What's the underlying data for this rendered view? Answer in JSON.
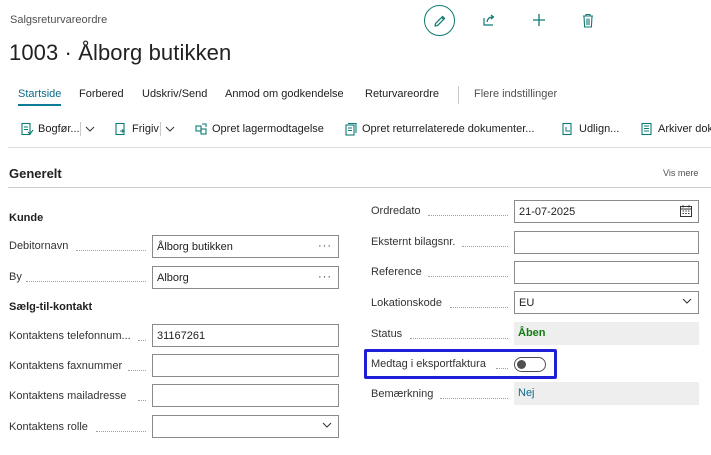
{
  "page": {
    "type": "Salgsreturvareordre",
    "title": "1003 · Ålborg butikken"
  },
  "header_actions": {
    "edit_icon": "pencil-icon",
    "share_icon": "share-icon",
    "add_icon": "plus-icon",
    "delete_icon": "trash-icon"
  },
  "tabs": [
    {
      "label": "Startside",
      "active": true
    },
    {
      "label": "Forbered"
    },
    {
      "label": "Udskriv/Send"
    },
    {
      "label": "Anmod om godkendelse"
    },
    {
      "label": "Returvareordre"
    },
    {
      "label": "Flere indstillinger"
    }
  ],
  "actions": [
    {
      "label": "Bogfør..."
    },
    {
      "label": "Frigiv"
    },
    {
      "label": "Opret lagermodtagelse"
    },
    {
      "label": "Opret returrelaterede dokumenter..."
    },
    {
      "label": "Udlign..."
    },
    {
      "label": "Arkiver dok"
    }
  ],
  "section": {
    "title": "Generelt",
    "show_more": "Vis mere"
  },
  "customer": {
    "group_title": "Kunde",
    "name_label": "Debitornavn",
    "name_value": "Ålborg butikken",
    "city_label": "By",
    "city_value": "Alborg"
  },
  "contact": {
    "group_title": "Sælg-til-kontakt",
    "phone_label": "Kontaktens telefonnum...",
    "phone_value": "31167261",
    "fax_label": "Kontaktens faxnummer",
    "fax_value": "",
    "email_label": "Kontaktens mailadresse",
    "email_value": "",
    "role_label": "Kontaktens rolle",
    "role_value": ""
  },
  "order": {
    "order_date_label": "Ordredato",
    "order_date_value": "21-07-2025",
    "external_doc_label": "Eksternt bilagsnr.",
    "external_doc_value": "",
    "reference_label": "Reference",
    "reference_value": "",
    "location_label": "Lokationskode",
    "location_value": "EU",
    "status_label": "Status",
    "status_value": "Åben",
    "export_invoice_label": "Medtag i eksportfaktura",
    "export_invoice_on": false,
    "remark_label": "Bemærkning",
    "remark_value": "Nej"
  },
  "colors": {
    "accent": "#0e7a73",
    "status_green": "#107c10",
    "highlight": "#1f1fd8",
    "link": "#0e6a8a"
  }
}
